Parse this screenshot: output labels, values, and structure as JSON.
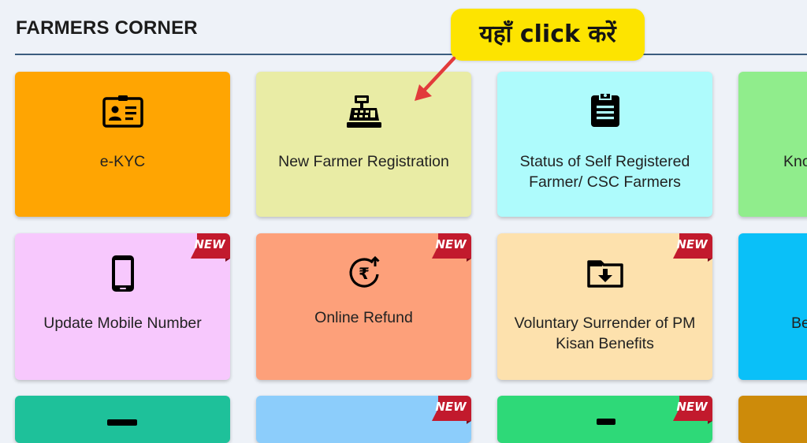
{
  "section": {
    "title": "FARMERS CORNER"
  },
  "callout": {
    "text": "यहाँ click करें",
    "color": "#fde400",
    "arrow_color": "#e23b3b"
  },
  "badge": {
    "label": "NEW",
    "color": "#c21a2d"
  },
  "cards": [
    {
      "label": "e-KYC",
      "icon": "id-card-icon",
      "color": "#ffa502",
      "new": false
    },
    {
      "label": "New Farmer Registration",
      "icon": "cash-register-icon",
      "color": "#e9eca5",
      "new": false
    },
    {
      "label": "Status of Self Registered Farmer/ CSC Farmers",
      "icon": "clipboard-list-icon",
      "color": "#aefbfc",
      "new": false
    },
    {
      "label": "Kno",
      "icon": "",
      "color": "#90ed8c",
      "new": false
    },
    {
      "label": "Update Mobile Number",
      "icon": "mobile-phone-icon",
      "color": "#f7c8fd",
      "new": true
    },
    {
      "label": "Online Refund",
      "icon": "rupee-refund-icon",
      "color": "#fda07a",
      "new": true
    },
    {
      "label": "Voluntary Surrender of PM Kisan Benefits",
      "icon": "folder-download-icon",
      "color": "#fde1ad",
      "new": true
    },
    {
      "label": "Be",
      "icon": "",
      "color": "#0ac0f8",
      "new": false
    },
    {
      "label": "",
      "icon": "",
      "color": "#1ec19a",
      "new": false
    },
    {
      "label": "",
      "icon": "",
      "color": "#8ccdfb",
      "new": true
    },
    {
      "label": "",
      "icon": "",
      "color": "#2ed978",
      "new": true
    },
    {
      "label": "",
      "icon": "",
      "color": "#cd8b0a",
      "new": false
    }
  ]
}
